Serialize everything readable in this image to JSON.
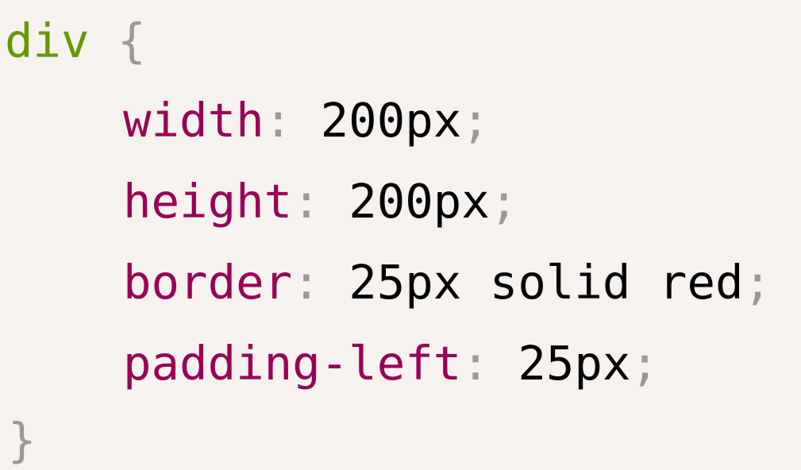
{
  "code": {
    "selector": "div",
    "open_brace": "{",
    "close_brace": "}",
    "declarations": [
      {
        "property": "width",
        "colon": ":",
        "value": " 200px",
        "semicolon": ";"
      },
      {
        "property": "height",
        "colon": ":",
        "value": " 200px",
        "semicolon": ";"
      },
      {
        "property": "border",
        "colon": ":",
        "value": " 25px solid red",
        "semicolon": ";"
      },
      {
        "property": "padding-left",
        "colon": ":",
        "value": " 25px",
        "semicolon": ";"
      }
    ]
  },
  "colors": {
    "background": "#f5f2f0",
    "selector": "#669900",
    "punctuation": "#999999",
    "property": "#990055",
    "value": "#000000"
  }
}
